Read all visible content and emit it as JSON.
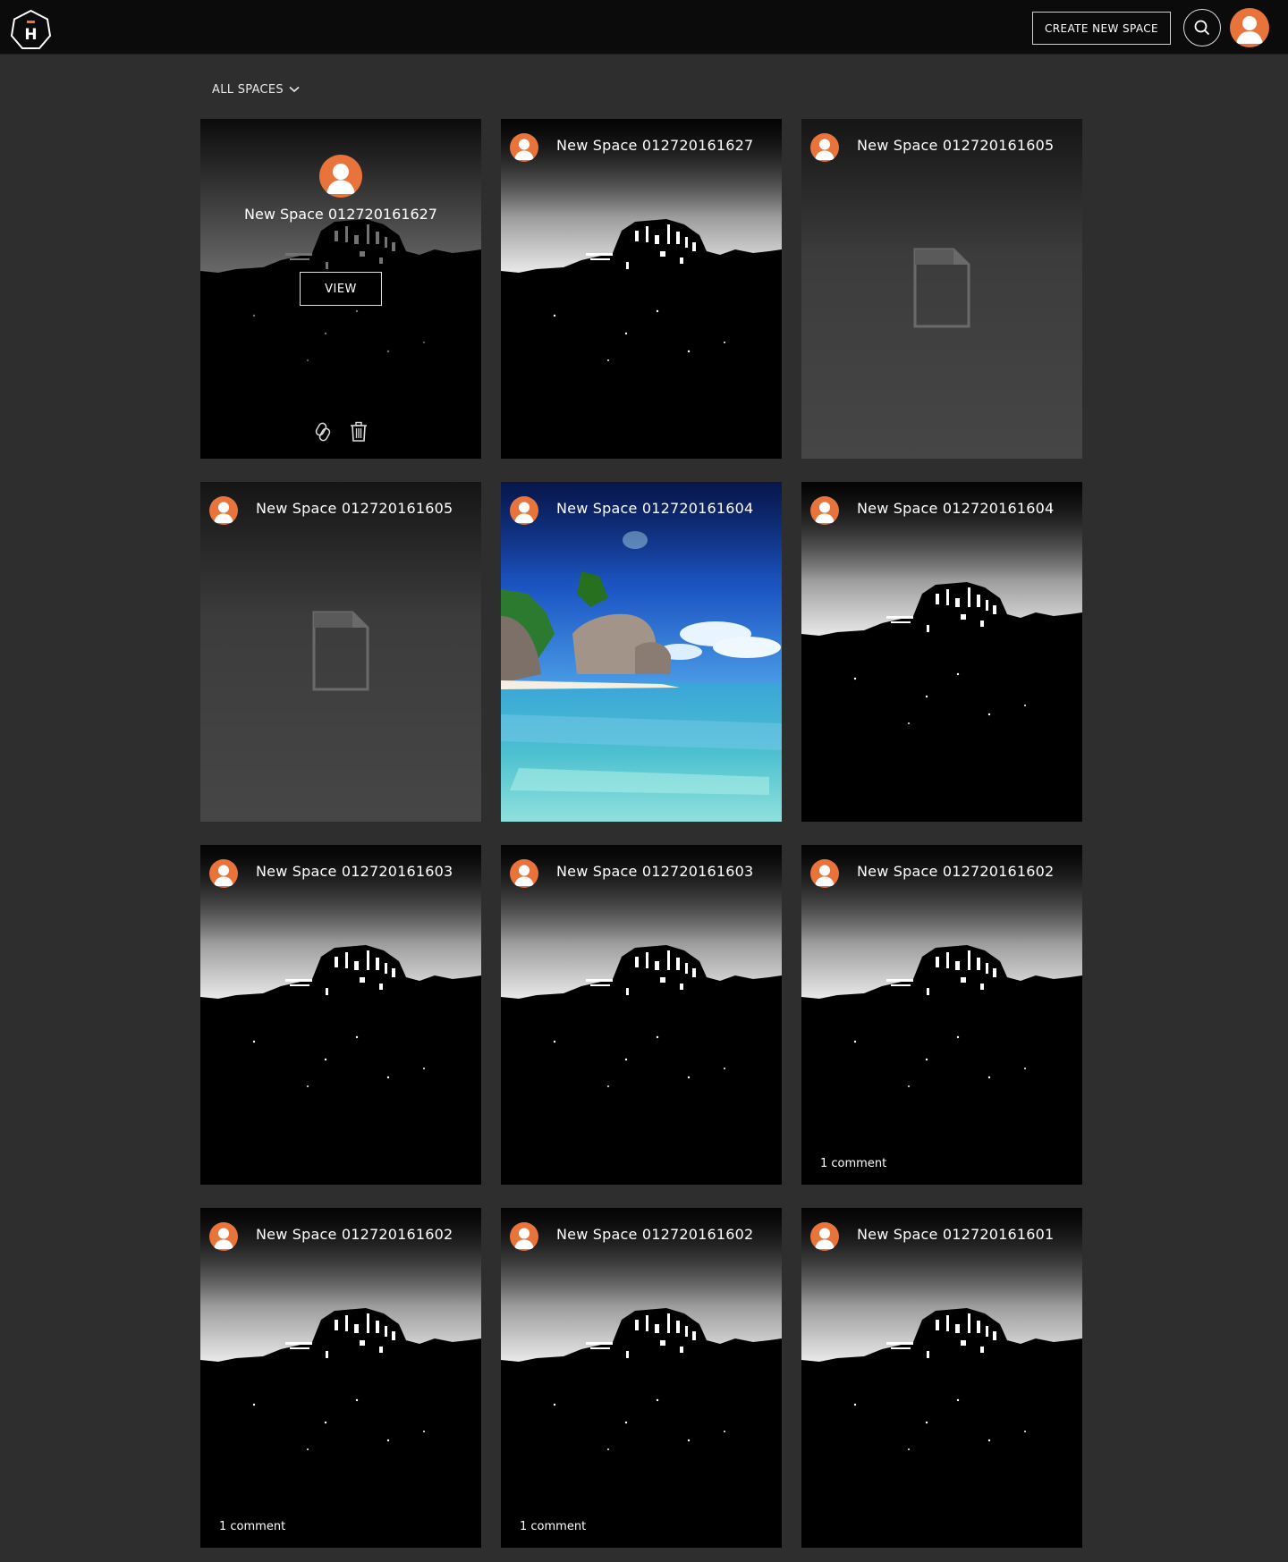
{
  "header": {
    "logo_icon": "hexagon-h-logo-icon",
    "create_label": "CREATE NEW SPACE",
    "search_icon": "search-icon",
    "avatar_icon": "user-avatar-icon"
  },
  "filter": {
    "label": "ALL SPACES",
    "icon": "chevron-down-icon"
  },
  "colors": {
    "accent": "#e8743b",
    "background": "#2e2e2e",
    "topbar": "#0b0b0b"
  },
  "hover_card": {
    "title": "New Space 012720161627",
    "view_label": "VIEW",
    "link_icon": "link-icon",
    "delete_icon": "trash-icon"
  },
  "cards": [
    {
      "title": "New Space 012720161627",
      "thumb": "rock-silhouette",
      "comments": ""
    },
    {
      "title": "New Space 012720161627",
      "thumb": "rock-silhouette",
      "comments": ""
    },
    {
      "title": "New Space 012720161605",
      "thumb": "empty-file",
      "comments": ""
    },
    {
      "title": "New Space 012720161605",
      "thumb": "empty-file",
      "comments": ""
    },
    {
      "title": "New Space 012720161604",
      "thumb": "beach-photo",
      "comments": ""
    },
    {
      "title": "New Space 012720161604",
      "thumb": "rock-silhouette",
      "comments": ""
    },
    {
      "title": "New Space 012720161603",
      "thumb": "rock-silhouette",
      "comments": ""
    },
    {
      "title": "New Space 012720161603",
      "thumb": "rock-silhouette",
      "comments": ""
    },
    {
      "title": "New Space 012720161602",
      "thumb": "rock-silhouette",
      "comments": "1 comment"
    },
    {
      "title": "New Space 012720161602",
      "thumb": "rock-silhouette",
      "comments": "1 comment"
    },
    {
      "title": "New Space 012720161602",
      "thumb": "rock-silhouette",
      "comments": "1 comment"
    },
    {
      "title": "New Space 012720161601",
      "thumb": "rock-silhouette",
      "comments": ""
    }
  ]
}
